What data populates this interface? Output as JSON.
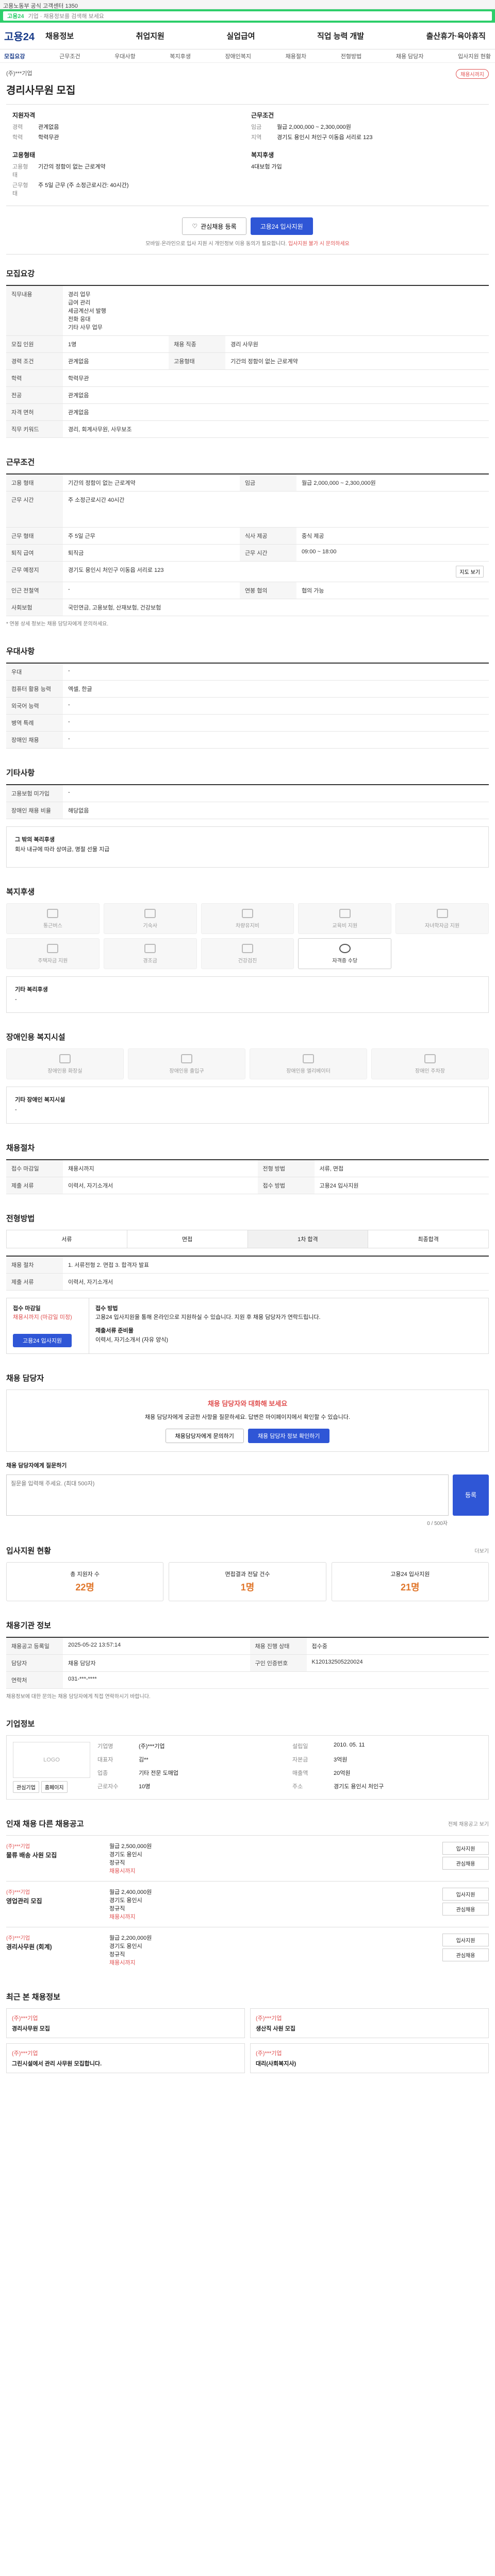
{
  "topstrip": "고용노동부 공식 고객센터 1350",
  "searchbar": {
    "label": "고용24",
    "placeholder": "기업 · 채용정보를 검색해 보세요"
  },
  "gnb": {
    "logo": "고용24",
    "menu": [
      "채용정보",
      "취업지원",
      "실업급여",
      "직업 능력 개발",
      "출산휴가·육아휴직"
    ]
  },
  "tabs": [
    "모집요강",
    "근무조건",
    "우대사항",
    "복지후생",
    "장애인복지",
    "채용절차",
    "전형방법",
    "채용 담당자",
    "입사지원 현황"
  ],
  "job": {
    "company": "(주)***기업",
    "badge": "채용시까지",
    "title": "경리사무원 모집",
    "req_title": "지원자격",
    "req": [
      {
        "k": "경력",
        "v": "관계없음"
      },
      {
        "k": "학력",
        "v": "학력무관"
      }
    ],
    "cond_title": "근무조건",
    "cond": [
      {
        "k": "임금",
        "v": "월급 2,000,000 ~ 2,300,000원"
      },
      {
        "k": "지역",
        "v": "경기도 용인시 처인구 이동읍 서리로 123"
      }
    ],
    "emp_title": "고용형태",
    "emp": [
      {
        "k": "고용형태",
        "v": "기간의 정함이 없는 근로계약"
      },
      {
        "k": "근무형태",
        "v": "주 5일 근무 (주 소정근로시간: 40시간)"
      }
    ],
    "welfare_title": "복지후생",
    "welfare": "4대보험 가입"
  },
  "actions": {
    "scrap": "관심채용 등록",
    "apply": "고용24 입사지원"
  },
  "note": {
    "text": "모바일·온라인으로 입사 지원 시 개인정보 이용 동의가 필요합니다.",
    "warn": "입사지원 불가 시 문의하세요"
  },
  "sections": {
    "recruit": "모집요강",
    "condition": "근무조건",
    "pref": "우대사항",
    "etc": "기타사항",
    "benefit": "복지후생",
    "disabled": "장애인용 복지시설",
    "process": "채용절차",
    "screen": "전형방법",
    "contact": "채용 담당자",
    "apply_stat": "입사지원 현황",
    "agency": "채용기관 정보",
    "company": "기업정보",
    "others": "인재 채용 다른 채용공고",
    "recent": "최근 본 채용정보"
  },
  "recruit": {
    "rows": [
      {
        "k": "직무내용",
        "v": "경리 업무\n급여 관리\n세금계산서 발행\n전화 응대\n기타 사무 업무"
      },
      {
        "k": "모집 인원",
        "v": "1명"
      },
      {
        "k": "경력 조건",
        "v": "관계없음"
      },
      {
        "k": "학력",
        "v": "학력무관"
      },
      {
        "k": "전공",
        "v": "관계없음"
      },
      {
        "k": "자격 면허",
        "v": "관계없음"
      },
      {
        "k": "직무 키워드",
        "v": "경리, 회계사무원, 사무보조"
      }
    ],
    "side": [
      {
        "k": "채용 직종",
        "v": "경리 사무원"
      },
      {
        "k": "고용형태",
        "v": "기간의 정함이 없는 근로계약"
      }
    ]
  },
  "condition": {
    "rows": [
      {
        "k": "고용 형태",
        "v": "기간의 정함이 없는 근로계약"
      },
      {
        "k": "근무 시간",
        "v": "주 소정근로시간 40시간"
      },
      {
        "k": "근무 형태",
        "v": "주 5일 근무"
      },
      {
        "k": "퇴직 급여",
        "v": "퇴직금"
      },
      {
        "k": "근무 예정지",
        "v": "경기도 용인시 처인구 이동읍 서리로 123"
      },
      {
        "k": "인근 전철역",
        "v": "-"
      },
      {
        "k": "사회보험",
        "v": "국민연금, 고용보험, 산재보험, 건강보험"
      }
    ],
    "side": [
      {
        "k": "임금",
        "v": "월급 2,000,000 ~ 2,300,000원"
      },
      {
        "k": "식사 제공",
        "v": "중식 제공"
      },
      {
        "k": "근무 시간",
        "v": "09:00 ~ 18:00"
      },
      {
        "k": "연봉 협의",
        "v": "협의 가능"
      }
    ],
    "map_btn": "지도 보기",
    "footnote": "* 연봉 상세 정보는 채용 담당자에게 문의하세요."
  },
  "pref": {
    "rows": [
      {
        "k": "우대",
        "v": "-"
      },
      {
        "k": "컴퓨터 활용 능력",
        "v": "엑셀, 한글"
      },
      {
        "k": "외국어 능력",
        "v": "-"
      },
      {
        "k": "병역 특례",
        "v": "-"
      },
      {
        "k": "장애인 채용",
        "v": "-"
      }
    ]
  },
  "etc": {
    "rows": [
      {
        "k": "고용보험 미가입",
        "v": "-"
      },
      {
        "k": "장애인 채용 비율",
        "v": "해당없음"
      }
    ]
  },
  "detail": {
    "title": "그 밖의 복리후생",
    "text": "회사 내규에 따라 상여금, 명절 선물 지급"
  },
  "benefit": {
    "items": [
      "통근버스",
      "기숙사",
      "차량유지비",
      "교육비 지원",
      "자녀학자금 지원",
      "주택자금 지원",
      "경조금",
      "건강검진",
      "자격증 수당"
    ],
    "active": 8,
    "etc_title": "기타 복리후생",
    "etc_text": "-"
  },
  "disabled": {
    "items": [
      "장애인용 화장실",
      "장애인용 출입구",
      "장애인용 엘리베이터",
      "장애인 주차장"
    ],
    "etc_title": "기타 장애인 복지시설",
    "etc_text": "-"
  },
  "process": {
    "rows": [
      {
        "k": "접수 마감일",
        "v": "채용시까지"
      },
      {
        "k": "전형 방법",
        "v": "서류, 면접"
      },
      {
        "k": "제출 서류",
        "v": "이력서, 자기소개서"
      },
      {
        "k": "접수 방법",
        "v": "고용24 입사지원"
      }
    ]
  },
  "screen": {
    "steps": [
      "서류",
      "면접",
      "1차 합격",
      "최종합격"
    ],
    "active": 2,
    "rows": [
      {
        "k": "채용 절차",
        "v": "1. 서류전형 2. 면접 3. 합격자 발표"
      },
      {
        "k": "제출 서류",
        "v": "이력서, 자기소개서"
      }
    ]
  },
  "applybox": {
    "left_title": "접수 마감일",
    "left_deadline": "채용시까지 (마감일 미정)",
    "left_btn": "고용24 입사지원",
    "right_title": "접수 방법",
    "right_text": "고용24 입사지원을 통해 온라인으로 지원하실 수 있습니다. 지원 후 채용 담당자가 연락드립니다.",
    "right_title2": "제출서류 준비물",
    "right_text2": "이력서, 자기소개서 (자유 양식)"
  },
  "contact": {
    "title": "채용 담당자와 대화해 보세요",
    "text": "채용 담당자에게 궁금한 사항을 질문하세요. 답변은 마이페이지에서 확인할 수 있습니다.",
    "btn1": "채용담당자에게 문의하기",
    "btn2": "채용 담당자 정보 확인하기",
    "ask_label": "채용 담당자에게 질문하기",
    "ask_placeholder": "질문을 입력해 주세요. (최대 500자)",
    "ask_btn": "등록",
    "counter": "0 / 500자"
  },
  "apply_stat": {
    "more": "더보기",
    "items": [
      {
        "k": "총 지원자 수",
        "v": "22명"
      },
      {
        "k": "면접결과 전달 건수",
        "v": "1명"
      },
      {
        "k": "고용24 입사지원",
        "v": "21명"
      }
    ]
  },
  "agency": {
    "rows": [
      {
        "k": "채용공고 등록일",
        "v": "2025-05-22 13:57:14"
      },
      {
        "k": "담당자",
        "v": "채용 담당자"
      },
      {
        "k": "연락처",
        "v": "031-***-****"
      }
    ],
    "side": [
      {
        "k": "채용 진행 상태",
        "v": "접수중"
      },
      {
        "k": "구인 인증번호",
        "v": "K120132505220024"
      }
    ],
    "notice": "채용정보에 대한 문의는 채용 담당자에게 직접 연락하시기 바랍니다."
  },
  "company": {
    "logo": "LOGO",
    "rows": [
      {
        "k": "기업명",
        "v": "(주)***기업"
      },
      {
        "k": "대표자",
        "v": "김**"
      },
      {
        "k": "업종",
        "v": "기타 전문 도매업"
      },
      {
        "k": "근로자수",
        "v": "10명"
      },
      {
        "k": "설립일",
        "v": "2010. 05. 11"
      },
      {
        "k": "자본금",
        "v": "3억원"
      },
      {
        "k": "매출액",
        "v": "20억원"
      },
      {
        "k": "주소",
        "v": "경기도 용인시 처인구"
      }
    ],
    "btn1": "관심기업",
    "btn2": "홈페이지"
  },
  "others": {
    "more": "전체 채용공고 보기",
    "items": [
      {
        "co": "(주)***기업",
        "title": "물류 배송 사원 모집",
        "wage": "월급 2,500,000원",
        "place": "경기도 용인시",
        "type": "정규직",
        "tag": "채용시까지",
        "b1": "입사지원",
        "b2": "관심채용"
      },
      {
        "co": "(주)***기업",
        "title": "영업관리 모집",
        "wage": "월급 2,400,000원",
        "place": "경기도 용인시",
        "type": "정규직",
        "tag": "채용시까지",
        "b1": "입사지원",
        "b2": "관심채용"
      },
      {
        "co": "(주)***기업",
        "title": "경리사무원 (회계)",
        "wage": "월급 2,200,000원",
        "place": "경기도 용인시",
        "type": "정규직",
        "tag": "채용시까지",
        "b1": "입사지원",
        "b2": "관심채용"
      }
    ]
  },
  "recent": {
    "items": [
      {
        "co": "(주)***기업",
        "title": "경리사무원 모집"
      },
      {
        "co": "(주)***기업",
        "title": "생산직 사원 모집"
      },
      {
        "co": "(주)***기업",
        "title": "그린시설에서 관리 사무원 모집합니다."
      },
      {
        "co": "(주)***기업",
        "title": "대리(사회복지사)"
      }
    ]
  }
}
